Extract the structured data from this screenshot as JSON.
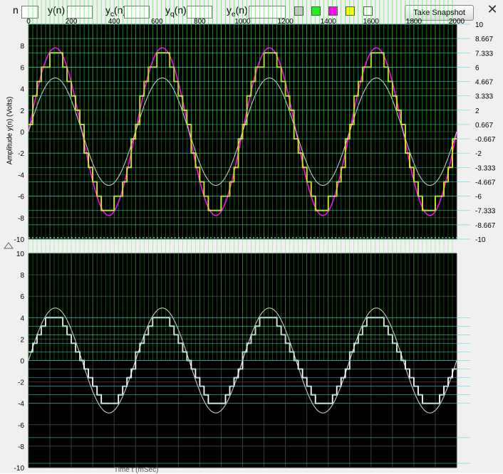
{
  "toolbar": {
    "n_label": "n",
    "yn_label": "y(n)",
    "yc_label": "y",
    "yc_sub": "c",
    "yc_suffix": "(n)",
    "yq_label": "y",
    "yq_sub": "q",
    "yq_suffix": "(n)",
    "ye_label": "y",
    "ye_sub": "e",
    "ye_suffix": "(n)",
    "n_value": "",
    "yn_value": "",
    "yc_value": "",
    "yq_value": "",
    "ye_value": "",
    "snapshot_label": "Take Snapshot",
    "close_glyph": "✕",
    "swatches": [
      "#c8c8c8",
      "#22ee22",
      "#ff00ff",
      "#ffff00",
      "#ffffff"
    ]
  },
  "top_plot": {
    "x_ticks": [
      "0",
      "200",
      "400",
      "600",
      "800",
      "1000",
      "1200",
      "1400",
      "1600",
      "1800",
      "2000"
    ],
    "left_y_ticks": [
      "8",
      "6",
      "4",
      "2",
      "0",
      "-2",
      "-4",
      "-6",
      "-8",
      "-10"
    ],
    "right_y_ticks": [
      "10",
      "8.667",
      "7.333",
      "6",
      "4.667",
      "3.333",
      "2",
      "0.667",
      "-0.667",
      "-2",
      "-3.333",
      "-4.667",
      "-6",
      "-7.333",
      "-8.667",
      "-10"
    ],
    "ylabel": "Amplitude y(n) (Volts)"
  },
  "bottom_plot": {
    "left_y_ticks": [
      "10",
      "8",
      "6",
      "4",
      "2",
      "0",
      "-2",
      "-4",
      "-6",
      "-8",
      "-10"
    ],
    "xlabel": "Time t (mSec)"
  },
  "chart_data": [
    {
      "type": "line",
      "title": "",
      "xlabel": "",
      "ylabel": "Amplitude y(n) (Volts)",
      "xlim": [
        0,
        2000
      ],
      "ylim": [
        -10,
        10
      ],
      "grid": true,
      "series": [
        {
          "color": "#ff00ff",
          "function": "sine",
          "amplitude": 7.8,
          "period_ms": 500
        },
        {
          "color": "#c8c8c8",
          "function": "sine",
          "amplitude": 5.0,
          "period_ms": 500
        },
        {
          "color": "#ffff00",
          "function": "quantized sine",
          "amplitude": 7.333,
          "period_ms": 500,
          "levels": [
            10,
            8.667,
            7.333,
            6,
            4.667,
            3.333,
            2,
            0.667,
            -0.667,
            -2,
            -3.333,
            -4.667,
            -6,
            -7.333,
            -8.667,
            -10
          ]
        },
        {
          "color": "#22ee22",
          "function": "samples",
          "amplitude": 5.0,
          "sample_interval_ms": 20
        }
      ]
    },
    {
      "type": "line",
      "title": "",
      "xlabel": "Time t (mSec)",
      "ylabel": "",
      "xlim": [
        0,
        2000
      ],
      "ylim": [
        -10,
        10
      ],
      "grid": true,
      "series": [
        {
          "color": "#c8c8c8",
          "function": "sine",
          "amplitude": 4.9,
          "period_ms": 500
        },
        {
          "color": "#ffffff",
          "function": "quantized sine",
          "amplitude": 4.0,
          "period_ms": 500
        },
        {
          "color": "#22ee22",
          "function": "samples",
          "amplitude": 4.9,
          "sample_interval_ms": 20
        }
      ]
    }
  ]
}
